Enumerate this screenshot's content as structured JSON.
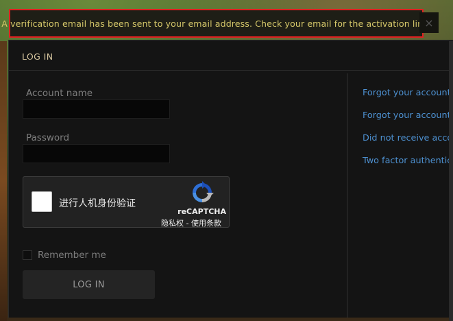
{
  "notification": {
    "message": "A verification email has been sent to your email address. Check your email for the activation link.",
    "close_symbol": "×"
  },
  "login": {
    "title": "LOG IN",
    "account_label": "Account name",
    "account_value": "",
    "password_label": "Password",
    "password_value": "",
    "remember_label": "Remember me",
    "submit_label": "LOG IN"
  },
  "captcha": {
    "checkbox_text": "进行人机身份验证",
    "brand": "reCAPTCHA",
    "links": "隐私权 - 使用条款"
  },
  "help_links": [
    "Forgot your account password?",
    "Forgot your account username?",
    "Did not receive account activation email?",
    "Two factor authentication"
  ],
  "colors": {
    "notice_text": "#d6c86a",
    "notice_border": "#e02020",
    "link": "#4d90d0",
    "title": "#d8c7a0"
  }
}
